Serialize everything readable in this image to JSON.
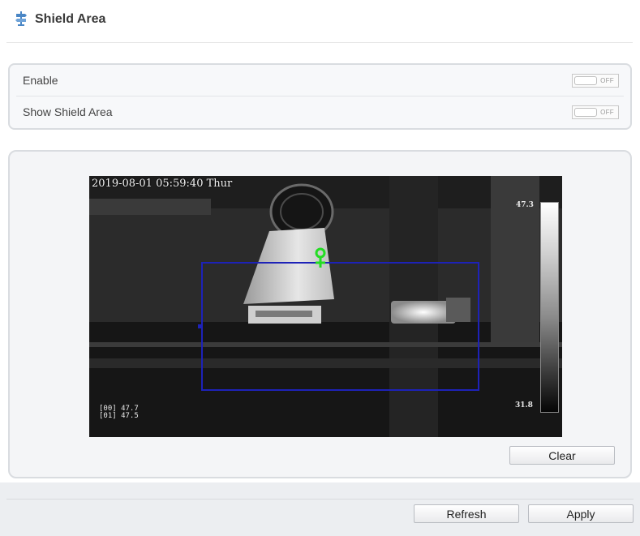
{
  "header": {
    "title": "Shield Area",
    "icon": "signpost-icon"
  },
  "settings": [
    {
      "label": "Enable",
      "toggle_text": "OFF",
      "state": "off"
    },
    {
      "label": "Show Shield Area",
      "toggle_text": "OFF",
      "state": "off"
    }
  ],
  "video": {
    "timestamp": "2019-08-01 05:59:40 Thur",
    "scale_max": "47.3",
    "scale_min": "31.8",
    "readings": [
      "[00] 47.7",
      "[01] 47.5"
    ],
    "shield_color": "#1d22b8",
    "marker_color": "#22dd22"
  },
  "buttons": {
    "clear": "Clear",
    "refresh": "Refresh",
    "apply": "Apply"
  }
}
